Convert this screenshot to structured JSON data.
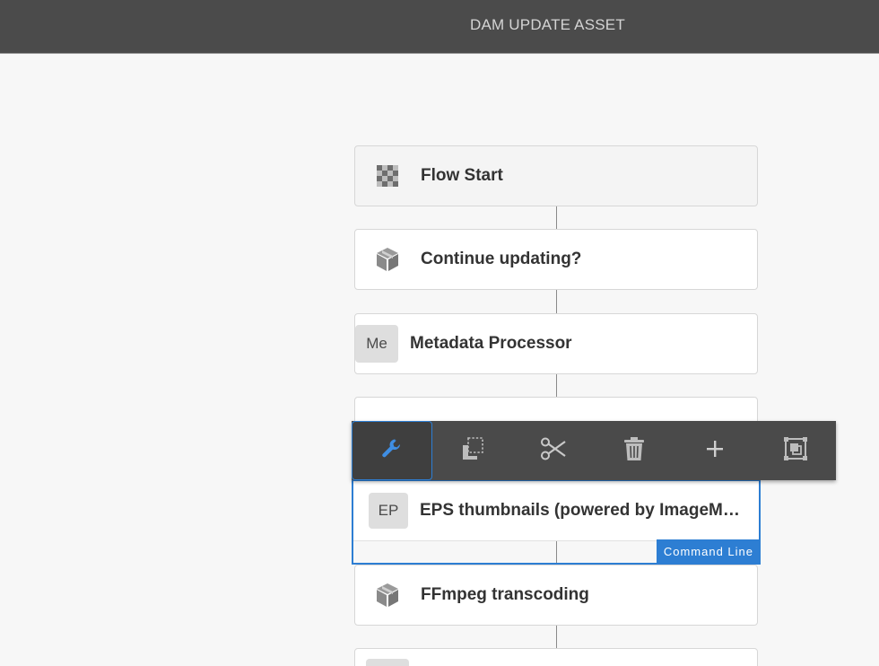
{
  "header": {
    "title": "DAM UPDATE ASSET"
  },
  "nodes": [
    {
      "label": "Flow Start",
      "icon": "checkerboard-icon"
    },
    {
      "label": "Continue updating?",
      "icon": "cube-icon"
    },
    {
      "label": "Metadata Processor",
      "abbr": "Me"
    },
    {
      "label": "EPS thumbnails (powered by ImageMa...",
      "abbr": "EP",
      "badge": "Command Line"
    },
    {
      "label": "FFmpeg transcoding",
      "icon": "cube-icon"
    }
  ],
  "toolbar": {
    "tools": [
      {
        "name": "configure",
        "icon": "wrench-icon"
      },
      {
        "name": "copy",
        "icon": "copy-icon"
      },
      {
        "name": "cut",
        "icon": "scissors-icon"
      },
      {
        "name": "delete",
        "icon": "trash-icon"
      },
      {
        "name": "insert",
        "icon": "plus-icon"
      },
      {
        "name": "group",
        "icon": "group-icon"
      }
    ]
  },
  "colors": {
    "accent": "#2d7ed3",
    "titlebar": "#4b4b4b",
    "toolbar": "#4a4a4a"
  }
}
